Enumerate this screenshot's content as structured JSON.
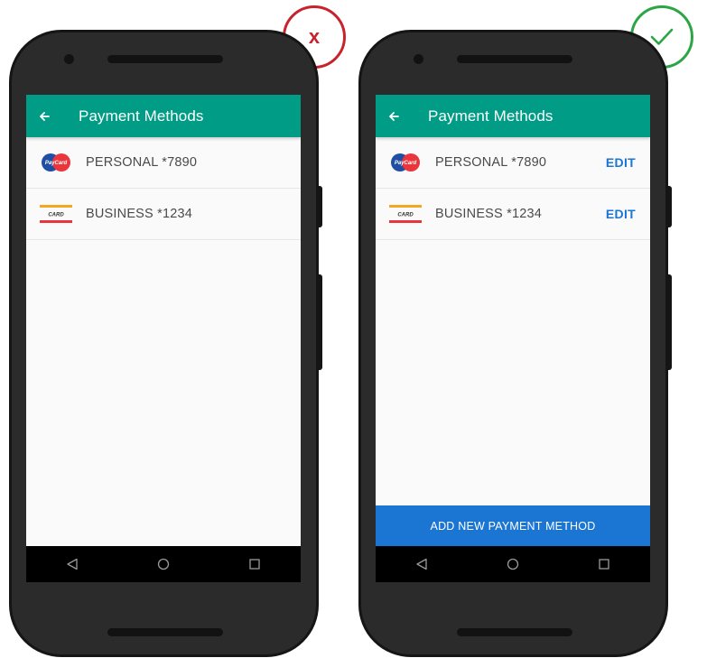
{
  "badges": {
    "incorrect": {
      "symbol": "x",
      "color": "#c8232c"
    },
    "correct": {
      "icon": "checkmark-icon",
      "color": "#2ca545"
    }
  },
  "app": {
    "title": "Payment Methods",
    "header_color": "#009c86",
    "accent_color": "#1a76d2"
  },
  "payment_methods": [
    {
      "label": "PERSONAL *7890",
      "icon": "paycard-icon",
      "icon_text": "PayCard"
    },
    {
      "label": "BUSINESS *1234",
      "icon": "card-icon",
      "icon_text": "CARD"
    }
  ],
  "actions": {
    "edit_label": "EDIT",
    "add_label": "ADD NEW PAYMENT METHOD"
  },
  "navbar": {
    "icons": [
      "back-triangle-icon",
      "home-circle-icon",
      "recents-square-icon"
    ]
  }
}
